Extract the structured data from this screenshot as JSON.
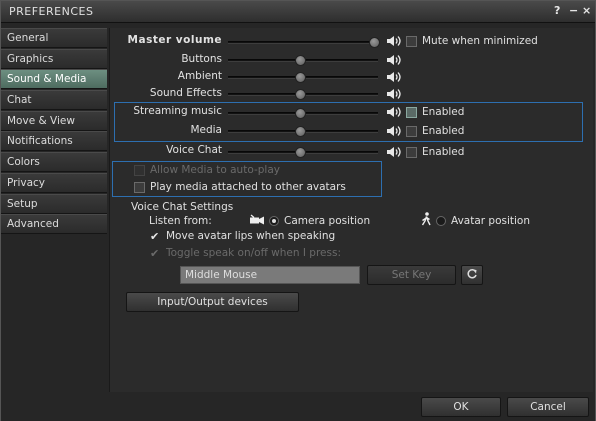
{
  "window": {
    "title": "PREFERENCES",
    "help": "?",
    "minimize": "−",
    "close": "×"
  },
  "sidebar": {
    "items": [
      {
        "label": "General"
      },
      {
        "label": "Graphics"
      },
      {
        "label": "Sound & Media"
      },
      {
        "label": "Chat"
      },
      {
        "label": "Move & View"
      },
      {
        "label": "Notifications"
      },
      {
        "label": "Colors"
      },
      {
        "label": "Privacy"
      },
      {
        "label": "Setup"
      },
      {
        "label": "Advanced"
      }
    ],
    "active": "Sound & Media"
  },
  "volume": {
    "master": {
      "label": "Master volume",
      "level": 1.0,
      "mute_label": "Mute when minimized",
      "mute_checked": false
    },
    "buttons": {
      "label": "Buttons",
      "level": 0.5
    },
    "ambient": {
      "label": "Ambient",
      "level": 0.5
    },
    "sound_effects": {
      "label": "Sound Effects",
      "level": 0.5
    },
    "streaming_music": {
      "label": "Streaming music",
      "level": 0.5,
      "enabled_label": "Enabled",
      "enabled": false
    },
    "media": {
      "label": "Media",
      "level": 0.5,
      "enabled_label": "Enabled",
      "enabled": false
    },
    "voice_chat": {
      "label": "Voice Chat",
      "level": 0.5,
      "enabled_label": "Enabled",
      "enabled": false
    }
  },
  "media_options": {
    "auto_play_label": "Allow Media to auto-play",
    "auto_play_enabled": false,
    "attached_label": "Play media attached to other avatars",
    "attached_checked": false
  },
  "voice_settings": {
    "heading": "Voice Chat Settings",
    "listen_from": "Listen from:",
    "camera_position": "Camera position",
    "avatar_position": "Avatar position",
    "selected": "Camera position",
    "move_lips_label": "Move avatar lips when speaking",
    "move_lips_checked": true,
    "toggle_speak_label": "Toggle speak on/off when I press:",
    "toggle_speak_checked": true,
    "key_value": "Middle Mouse",
    "set_key_label": "Set Key",
    "io_devices_label": "Input/Output devices"
  },
  "footer": {
    "ok_label": "OK",
    "cancel_label": "Cancel"
  }
}
